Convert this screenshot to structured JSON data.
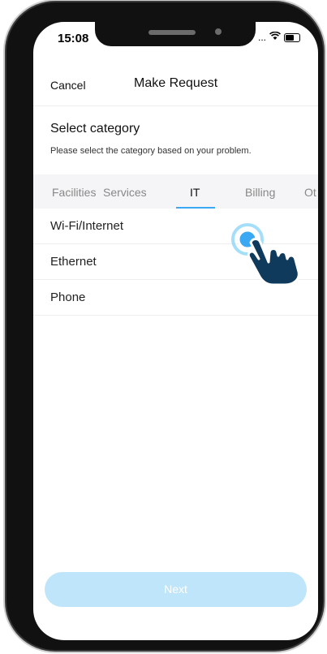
{
  "status_bar": {
    "time": "15:08",
    "signal": "...",
    "wifi": "wifi-icon",
    "battery": "battery-icon"
  },
  "nav": {
    "cancel_label": "Cancel",
    "title": "Make Request"
  },
  "section": {
    "title": "Select category",
    "subtitle": "Please select the category based on your problem."
  },
  "tabs": [
    {
      "label": "Facilities",
      "active": false
    },
    {
      "label": "Services",
      "active": false
    },
    {
      "label": "IT",
      "active": true
    },
    {
      "label": "Billing",
      "active": false
    },
    {
      "label": "Ot",
      "active": false
    }
  ],
  "list": [
    {
      "label": "Wi-Fi/Internet"
    },
    {
      "label": "Ethernet"
    },
    {
      "label": "Phone"
    }
  ],
  "footer": {
    "next_label": "Next"
  },
  "colors": {
    "accent": "#3aa8f2",
    "button_disabled": "#bfe5fb",
    "tab_bg": "#f5f5f7"
  },
  "overlay": {
    "icon": "tap-hand-icon"
  }
}
